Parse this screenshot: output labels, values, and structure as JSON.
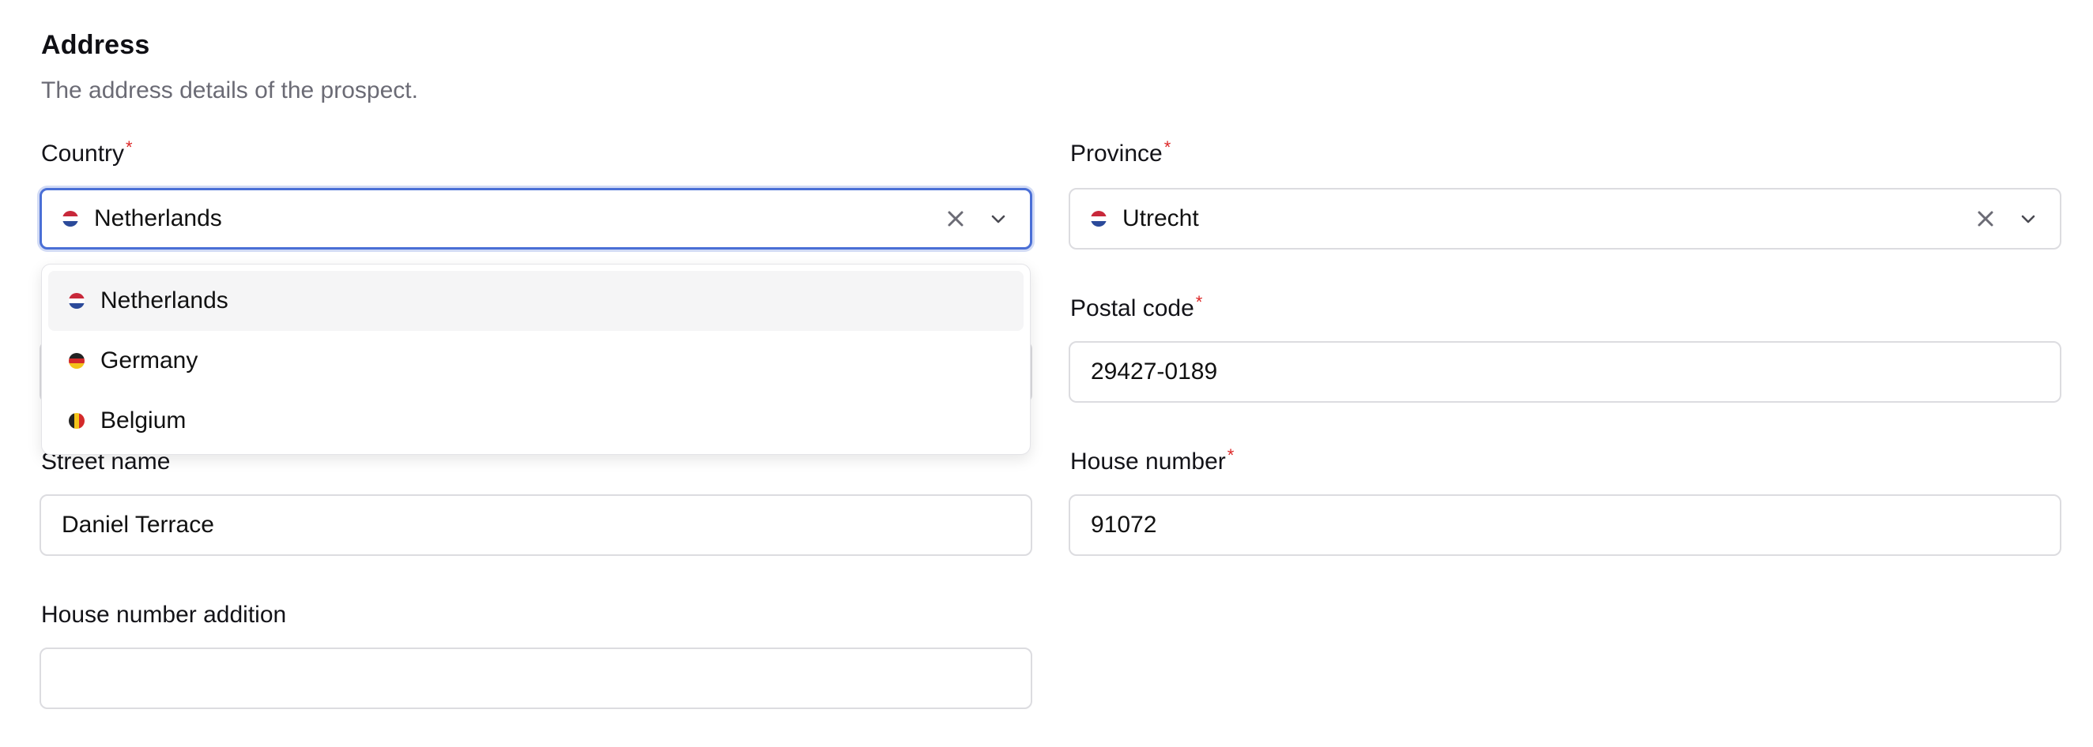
{
  "section": {
    "title": "Address",
    "description": "The address details of the prospect."
  },
  "country": {
    "label": "Country",
    "required_mark": "*",
    "value": "Netherlands",
    "flag": "netherlands-flag",
    "options": [
      {
        "label": "Netherlands",
        "flag": "netherlands-flag"
      },
      {
        "label": "Germany",
        "flag": "germany-flag"
      },
      {
        "label": "Belgium",
        "flag": "belgium-flag"
      }
    ]
  },
  "province": {
    "label": "Province",
    "required_mark": "*",
    "value": "Utrecht",
    "flag": "netherlands-flag"
  },
  "postal_code": {
    "label": "Postal code",
    "required_mark": "*",
    "value": "29427-0189"
  },
  "street_name": {
    "label": "Street name",
    "value": "Daniel Terrace"
  },
  "house_number": {
    "label": "House number",
    "required_mark": "*",
    "value": "91072"
  },
  "house_number_addition": {
    "label": "House number addition",
    "value": ""
  },
  "colors": {
    "focus_border": "#4a6fd6",
    "required": "#dc2626",
    "muted_text": "#6b6b75"
  }
}
